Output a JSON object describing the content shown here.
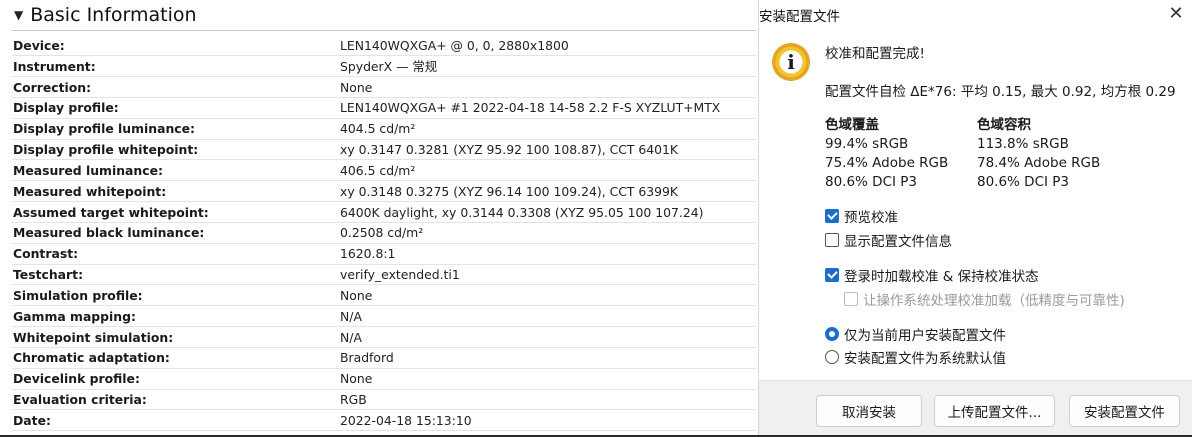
{
  "report": {
    "title": "Basic Information",
    "rows": [
      {
        "label": "Device:",
        "value": "LEN140WQXGA+ @ 0, 0, 2880x1800"
      },
      {
        "label": "Instrument:",
        "value": "SpyderX — 常规"
      },
      {
        "label": "Correction:",
        "value": "None"
      },
      {
        "label": "Display profile:",
        "value": "LEN140WQXGA+ #1 2022-04-18 14-58 2.2 F-S XYZLUT+MTX"
      },
      {
        "label": "Display profile luminance:",
        "value": "404.5 cd/m²"
      },
      {
        "label": "Display profile whitepoint:",
        "value": "xy 0.3147 0.3281 (XYZ 95.92 100 108.87), CCT 6401K"
      },
      {
        "label": "Measured luminance:",
        "value": "406.5 cd/m²"
      },
      {
        "label": "Measured whitepoint:",
        "value": "xy 0.3148 0.3275 (XYZ 96.14 100 109.24), CCT 6399K"
      },
      {
        "label": "Assumed target whitepoint:",
        "value": "6400K daylight, xy 0.3144 0.3308 (XYZ 95.05 100 107.24)"
      },
      {
        "label": "Measured black luminance:",
        "value": "0.2508 cd/m²"
      },
      {
        "label": "Contrast:",
        "value": "1620.8:1"
      },
      {
        "label": "Testchart:",
        "value": "verify_extended.ti1"
      },
      {
        "label": "Simulation profile:",
        "value": "None"
      },
      {
        "label": "Gamma mapping:",
        "value": "N/A"
      },
      {
        "label": "Whitepoint simulation:",
        "value": "N/A"
      },
      {
        "label": "Chromatic adaptation:",
        "value": "Bradford"
      },
      {
        "label": "Devicelink profile:",
        "value": "None"
      },
      {
        "label": "Evaluation criteria:",
        "value": "RGB"
      },
      {
        "label": "Date:",
        "value": "2022-04-18 15:13:10"
      }
    ]
  },
  "dialog": {
    "title": "安装配置文件",
    "close_glyph": "✕",
    "info_glyph": "i",
    "message": "校准和配置完成!",
    "self_check": "配置文件自检 ΔE*76: 平均 0.15, 最大 0.92, 均方根 0.29",
    "gamut_coverage": {
      "heading": "色域覆盖",
      "lines": [
        "99.4% sRGB",
        "75.4% Adobe RGB",
        "80.6% DCI P3"
      ]
    },
    "gamut_volume": {
      "heading": "色域容积",
      "lines": [
        "113.8% sRGB",
        "78.4% Adobe RGB",
        "80.6% DCI P3"
      ]
    },
    "preview_calibration": {
      "label": "预览校准",
      "checked": true
    },
    "show_profile_info": {
      "label": "显示配置文件信息",
      "checked": false
    },
    "load_on_login": {
      "label": "登录时加载校准 & 保持校准状态",
      "checked": true
    },
    "let_os_handle": {
      "label": "让操作系统处理校准加载（低精度与可靠性)",
      "checked": false,
      "disabled": true
    },
    "scope_options": [
      {
        "label": "仅为当前用户安装配置文件",
        "selected": true
      },
      {
        "label": "安装配置文件为系统默认值",
        "selected": false
      }
    ],
    "buttons": {
      "cancel": "取消安装",
      "upload": "上传配置文件...",
      "install": "安装配置文件"
    },
    "colors": {
      "accent": "#1a6ec8",
      "icon_ring": "#f1c232"
    }
  }
}
